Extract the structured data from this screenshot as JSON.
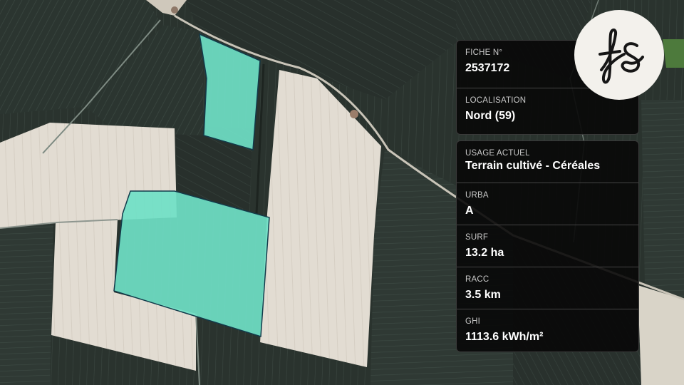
{
  "card": {
    "fiche": {
      "label": "FICHE N°",
      "value": "2537172"
    },
    "localisation": {
      "label": "LOCALISATION",
      "value": "Nord (59)"
    },
    "usage": {
      "label": "USAGE ACTUEL",
      "value": "Terrain cultivé - Céréales"
    },
    "urba": {
      "label": "URBA",
      "value": "A"
    },
    "surf": {
      "label": "SURF",
      "value": "13.2 ha"
    },
    "racc": {
      "label": "RACC",
      "value": "3.5 km"
    },
    "ghi": {
      "label": "GHI",
      "value": "1113.6 kWh/m²"
    }
  },
  "logo": {
    "text": "fs"
  },
  "colors": {
    "parcel_fill": "#6fe0c6",
    "parcel_stroke": "#123a4a",
    "field_light": "#e3ddd3",
    "field_dark": "#27312c"
  }
}
